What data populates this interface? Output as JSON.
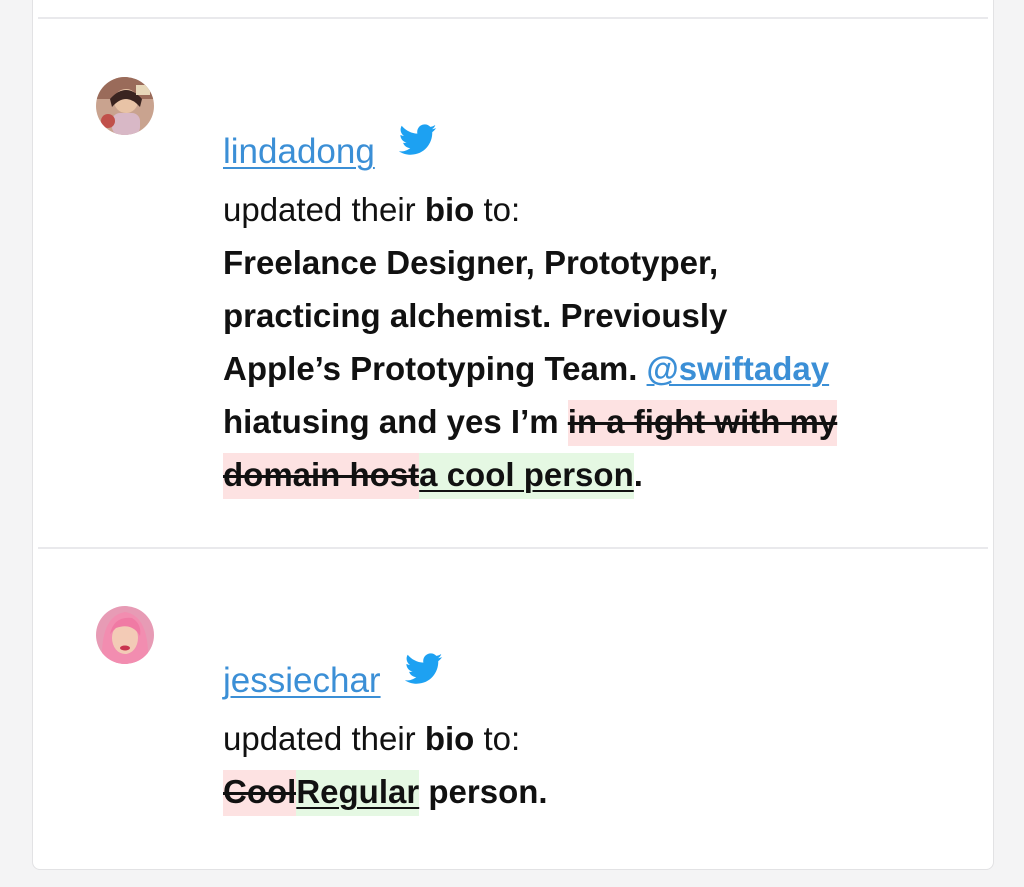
{
  "entries": [
    {
      "username": "lindadong",
      "action_prefix": "updated their ",
      "action_field": "bio",
      "action_suffix": " to:",
      "bio": {
        "line1": "Freelance Designer, Prototyper,",
        "line2": "practicing alchemist. Previously",
        "line3_text": "Apple’s Prototyping Team. ",
        "mention": "@swiftaday",
        "line4_text": "hiatusing and yes I’m ",
        "removed": "in a fight with my domain host",
        "added": "a cool person",
        "end": "."
      }
    },
    {
      "username": "jessiechar",
      "action_prefix": "updated their ",
      "action_field": "bio",
      "action_suffix": " to:",
      "bio": {
        "removed": "Cool",
        "added": "Regular",
        "rest": " person."
      }
    }
  ],
  "colors": {
    "link": "#3b8fd6",
    "twitter": "#1da1f2",
    "removed_bg": "#fde2e2",
    "added_bg": "#e5f8e3"
  },
  "icons": {
    "service": "twitter-bird-icon"
  }
}
